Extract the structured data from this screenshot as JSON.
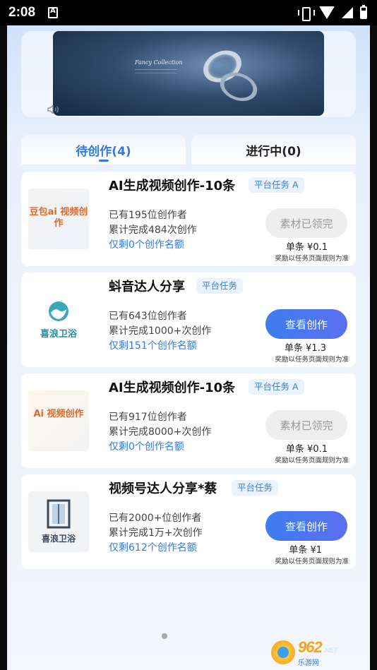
{
  "status_bar": {
    "time": "2:08"
  },
  "banner": {
    "title": "Fancy Collection"
  },
  "tabs": [
    {
      "label": "待创作(4)"
    },
    {
      "label": "进行中(0)"
    }
  ],
  "cards": [
    {
      "thumb_text": "豆包ai 视频创作",
      "title": "AI生成视频创作-10条",
      "tag": "平台任务 A",
      "creators": "已有195位创作者",
      "completed": "累计完成484次创作",
      "remaining": "仅剩0个创作名额",
      "button": "素材已领完",
      "price": "单条 ¥0.1",
      "note": "奖励以任务页面规则为准"
    },
    {
      "thumb_text": "喜浪卫浴",
      "title": "蚪音达人分享",
      "tag": "平台任务",
      "creators": "已有643位创作者",
      "completed": "累计完成1000+次创作",
      "remaining": "仅剩151个创作名额",
      "button": "查看创作",
      "price": "单条 ¥1.3",
      "note": "奖励以任务页面规则为准"
    },
    {
      "thumb_text": "Ai 视频创作",
      "title": "AI生成视频创作-10条",
      "tag": "平台任务 A",
      "creators": "已有917位创作者",
      "completed": "累计完成8000+次创作",
      "remaining": "仅剩0个创作名额",
      "button": "素材已领完",
      "price": "单条 ¥0.1",
      "note": "奖励以任务页面规则为准"
    },
    {
      "thumb_text": "喜浪卫浴",
      "title": "视频号达人分享*蔡",
      "tag": "平台任务",
      "creators": "已有2000+位创作者",
      "completed": "累计完成1万+次创作",
      "remaining": "仅剩612个创作名额",
      "button": "查看创作",
      "price": "单条 ¥1",
      "note": "奖励以任务页面规则为准"
    }
  ],
  "watermark": {
    "brand": "962",
    "suffix": ".NET",
    "sub": "乐游网"
  },
  "colors": {
    "accent": "#2f7be0",
    "button_gradient_start": "#3d7df0",
    "button_gradient_end": "#5b6ff0",
    "disabled": "#eeeeee"
  }
}
